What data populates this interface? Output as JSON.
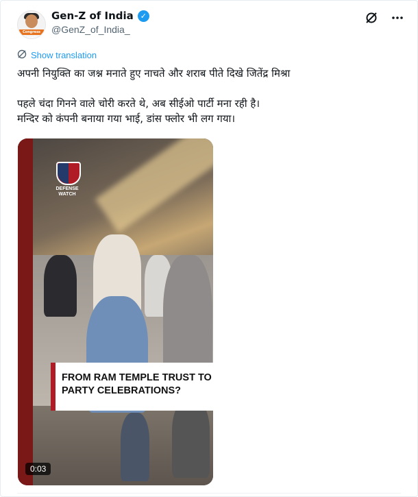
{
  "post": {
    "author": {
      "display_name": "Gen-Z of India",
      "handle": "@GenZ_of_India_",
      "avatar_label": "Congress Sevadal",
      "verified": true
    },
    "translate_label": "Show translation",
    "text": "अपनी नियुक्ति का जश्न मनाते हुए नाचते और शराब पीते दिखे जितेंद्र मिश्रा\n\nपहले चंदा गिनने वाले चोरी करते थे, अब सीईओ पार्टी मना रही है।\n मन्दिर को कंपनी बनाया गया भाई, डांस फ्लोर भी लग गया।",
    "media": {
      "caption": "FROM RAM TEMPLE TRUST TO PARTY CELEBRATIONS?",
      "logo_text": "DEFENSE WATCH",
      "timecode": "0:03"
    }
  },
  "icons": {
    "grok": "grok-icon",
    "more": "more-icon",
    "translate": "translate-icon",
    "verified": "verified-badge-icon"
  },
  "colors": {
    "link": "#1d9bf0",
    "verified": "#1d9bf0",
    "caption_accent": "#b01c25"
  }
}
